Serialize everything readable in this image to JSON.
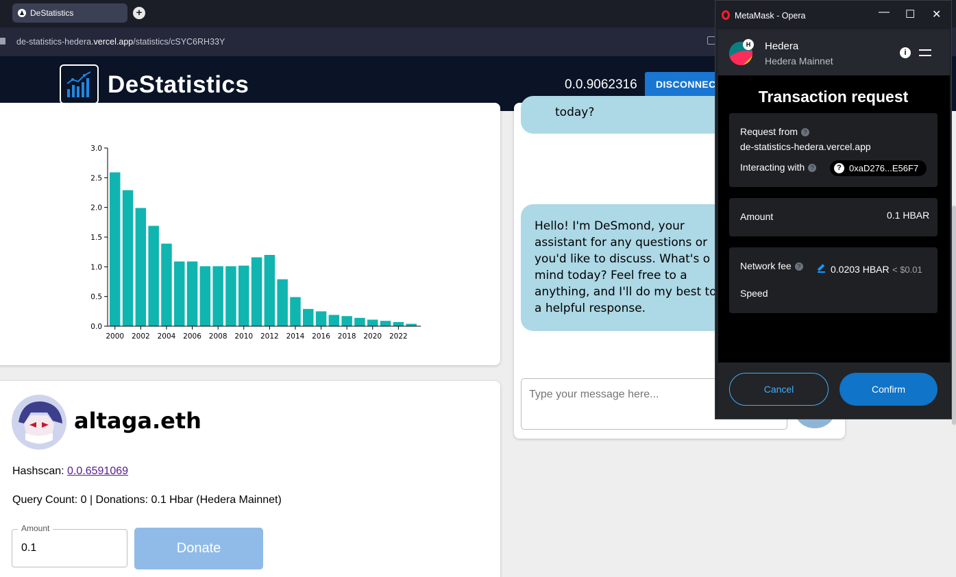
{
  "browser": {
    "tab_title": "DeStatistics",
    "new_tab": "+",
    "url_prefix": "de-statistics-hedera",
    "url_host": ".vercel.app",
    "url_path": "/statistics/cSYC6RH33Y"
  },
  "header": {
    "brand": "DeStatistics",
    "account_id": "0.0.9062316",
    "disconnect_label": "DISCONNECT"
  },
  "chart_data": {
    "type": "bar",
    "categories": [
      "2000",
      "2001",
      "2002",
      "2003",
      "2004",
      "2005",
      "2006",
      "2007",
      "2008",
      "2009",
      "2010",
      "2011",
      "2012",
      "2013",
      "2014",
      "2015",
      "2016",
      "2017",
      "2018",
      "2019",
      "2020",
      "2021",
      "2022",
      "2023"
    ],
    "values": [
      2.59,
      2.29,
      1.99,
      1.69,
      1.39,
      1.09,
      1.09,
      1.01,
      1.01,
      1.01,
      1.02,
      1.16,
      1.2,
      0.79,
      0.49,
      0.29,
      0.25,
      0.19,
      0.17,
      0.14,
      0.11,
      0.09,
      0.07,
      0.04
    ],
    "x_tick_labels": [
      "2000",
      "2002",
      "2004",
      "2006",
      "2008",
      "2010",
      "2012",
      "2014",
      "2016",
      "2018",
      "2020",
      "2022"
    ],
    "y_ticks": [
      "0.0",
      "0.5",
      "1.0",
      "1.5",
      "2.0",
      "2.5",
      "3.0"
    ],
    "ylim": [
      0,
      3.0
    ],
    "color": "#10b5b0"
  },
  "profile": {
    "username": "altaga.eth",
    "hashscan_label": "Hashscan: ",
    "hashscan_link": "0.0.6591069",
    "query_info": "Query Count: 0 | Donations: 0.1 Hbar (Hedera Mainnet)",
    "amount_label": "Amount",
    "amount_value": "0.1",
    "donate_label": "Donate"
  },
  "chat": {
    "bubble1": "today?",
    "bubble2_lines": [
      "Hello!  I'm  DeSmond,  your",
      "assistant for any questions or",
      "you'd like to discuss. What's o",
      "mind today? Feel free to a",
      "anything, and I'll do my best to",
      "a helpful response."
    ],
    "input_placeholder": "Type your message here..."
  },
  "metamask": {
    "window_title": "MetaMask - Opera",
    "controls": [
      "—",
      "☐",
      "✕"
    ],
    "network_badge": "H",
    "network_name": "Hedera",
    "network_sub": "Hedera Mainnet",
    "info_icon": "i",
    "title": "Transaction request",
    "request_from_label": "Request from",
    "request_from_value": "de-statistics-hedera.vercel.app",
    "interacting_label": "Interacting with",
    "interacting_value": "0xaD276...E56F7",
    "amount_label": "Amount",
    "amount_value": "0.1 HBAR",
    "fee_label": "Network fee",
    "fee_value": "0.0203 HBAR",
    "fee_fiat": "< $0.01",
    "speed_label": "Speed",
    "cancel_label": "Cancel",
    "confirm_label": "Confirm",
    "help_mark": "?"
  }
}
